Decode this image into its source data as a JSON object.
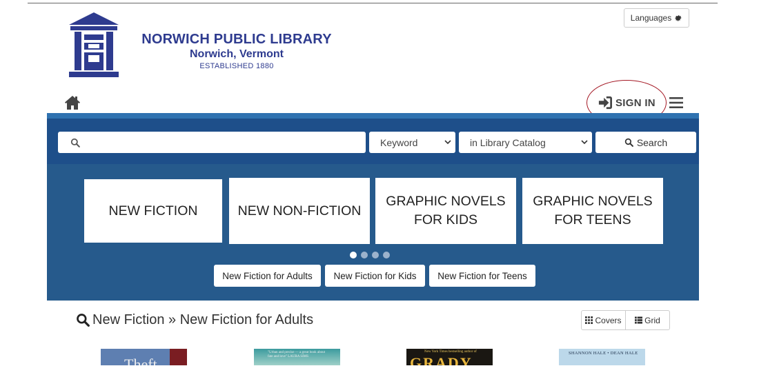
{
  "library": {
    "name": "NORWICH PUBLIC LIBRARY",
    "town": "Norwich, Vermont",
    "established": "ESTABLISHED 1880",
    "brand_color": "#2e3b8f"
  },
  "header": {
    "languages_label": "Languages",
    "signin_label": "SIGN IN",
    "icons": [
      "home-icon",
      "sign-in-icon",
      "menu-icon",
      "gear-icon"
    ],
    "annotation_color": "#a31622"
  },
  "search": {
    "input_value": "",
    "field_selected": "Keyword",
    "scope_selected": "in Library Catalog",
    "button_label": "Search",
    "band_color": "#1e4f8a"
  },
  "carousel": {
    "tiles": [
      "NEW FICTION",
      "NEW NON-FICTION",
      "GRAPHIC NOVELS\nFOR KIDS",
      "GRAPHIC NOVELS\nFOR TEENS"
    ],
    "active_dot": 0,
    "dot_count": 4,
    "pills": [
      "New Fiction for Adults",
      "New Fiction for Kids",
      "New Fiction for Teens"
    ],
    "background": "#265a8c"
  },
  "results": {
    "breadcrumb": "New Fiction » New Fiction for Adults",
    "view_covers_label": "Covers",
    "view_grid_label": "Grid",
    "covers": [
      {
        "text": "Theft"
      },
      {
        "text": "\"Urban and precise — a great book about fate and love\" LAURA SIMS"
      },
      {
        "tagline": "New York Times bestselling author of",
        "text": "GRADY"
      },
      {
        "text": "SHANNON HALE • DEAN HALE"
      }
    ]
  }
}
